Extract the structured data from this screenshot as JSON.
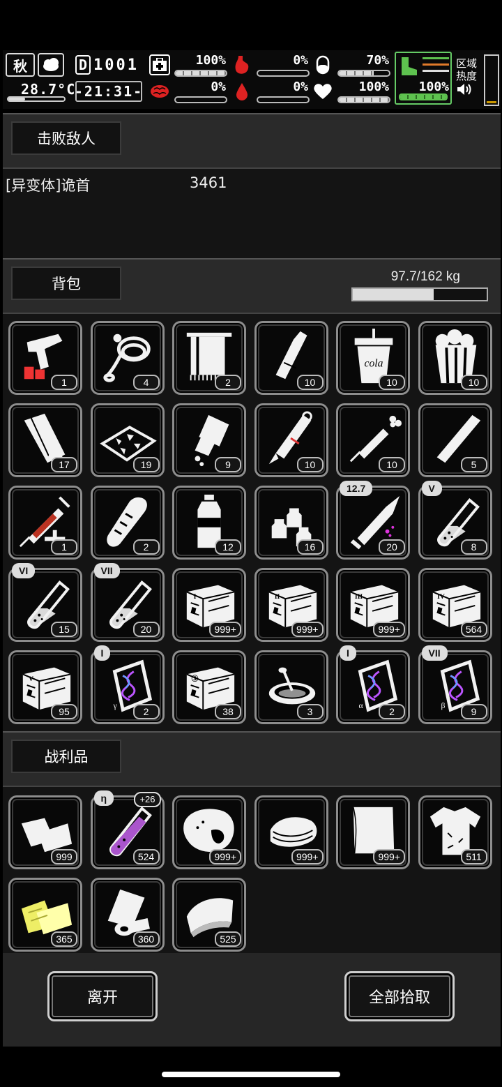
{
  "hud": {
    "season": "秋",
    "temperature": "28.7°C",
    "day": "1001",
    "day_prefix": "D",
    "clock": "-21:31-",
    "stats": [
      {
        "name": "health",
        "icon": "medkit-icon",
        "value": "100%",
        "level": 1.0,
        "color": "#ffffff"
      },
      {
        "name": "hunger",
        "icon": "stomach-icon",
        "value": "0%",
        "level": 0.0,
        "color": "#d33"
      },
      {
        "name": "pill",
        "icon": "pill-icon",
        "value": "70%",
        "level": 0.7,
        "color": "#ffffff"
      },
      {
        "name": "brain",
        "icon": "brain-icon",
        "value": "0%",
        "level": 0.0,
        "color": "#d33"
      },
      {
        "name": "blood",
        "icon": "blood-drop-icon",
        "value": "0%",
        "level": 0.0,
        "color": "#d33"
      },
      {
        "name": "heart",
        "icon": "heart-icon",
        "value": "100%",
        "level": 1.0,
        "color": "#ffffff"
      }
    ],
    "stamina": {
      "value": "100%",
      "level": 1.0,
      "color": "#5ec24f"
    },
    "zone_label_line1": "区域",
    "zone_label_line2": "热度"
  },
  "defeat": {
    "title": "击败敌人",
    "enemy_name": "[异变体]诡首",
    "enemy_count": "3461"
  },
  "backpack": {
    "title": "背包",
    "weight": "97.7/162 kg",
    "weight_level": 0.603,
    "items": [
      {
        "icon": "flare-gun-icon",
        "qty": "1"
      },
      {
        "icon": "rope-icon",
        "qty": "4"
      },
      {
        "icon": "towel-icon",
        "qty": "2"
      },
      {
        "icon": "bottle-icon",
        "qty": "10"
      },
      {
        "icon": "cola-cup-icon",
        "qty": "10",
        "label": "cola"
      },
      {
        "icon": "popcorn-icon",
        "qty": "10"
      },
      {
        "icon": "bandage-icon",
        "qty": "17"
      },
      {
        "icon": "snack-tray-icon",
        "qty": "19"
      },
      {
        "icon": "pill-bottle-icon",
        "qty": "9"
      },
      {
        "icon": "injector-icon",
        "qty": "10"
      },
      {
        "icon": "syringe-icon",
        "qty": "10"
      },
      {
        "icon": "cigarette-icon",
        "qty": "5"
      },
      {
        "icon": "blood-syringe-icon",
        "qty": "1"
      },
      {
        "icon": "bread-icon",
        "qty": "2"
      },
      {
        "icon": "water-bottle-icon",
        "qty": "12"
      },
      {
        "icon": "vials-icon",
        "qty": "16"
      },
      {
        "icon": "bullet-icon",
        "qty": "20",
        "tag": "12.7"
      },
      {
        "icon": "test-tube-icon",
        "qty": "8",
        "tag": "V"
      },
      {
        "icon": "test-tube-icon",
        "qty": "15",
        "tag": "VI"
      },
      {
        "icon": "test-tube-icon",
        "qty": "20",
        "tag": "VII"
      },
      {
        "icon": "crate-icon",
        "qty": "999+",
        "roman": "I"
      },
      {
        "icon": "crate-icon",
        "qty": "999+",
        "roman": "II"
      },
      {
        "icon": "crate-icon",
        "qty": "999+",
        "roman": "III"
      },
      {
        "icon": "crate-icon",
        "qty": "564",
        "roman": "IV"
      },
      {
        "icon": "crate-icon",
        "qty": "95",
        "roman": "V"
      },
      {
        "icon": "dna-capsule-icon",
        "qty": "2",
        "tag": "I",
        "greek": "γ"
      },
      {
        "icon": "crate-icon",
        "qty": "38",
        "roman": "Ⓢ"
      },
      {
        "icon": "bowl-icon",
        "qty": "3"
      },
      {
        "icon": "dna-capsule-icon",
        "qty": "2",
        "tag": "I",
        "greek": "α"
      },
      {
        "icon": "dna-capsule-icon",
        "qty": "9",
        "tag": "VII",
        "greek": "β"
      }
    ]
  },
  "loot": {
    "title": "战利品",
    "items": [
      {
        "icon": "cloth-icon",
        "qty": "999"
      },
      {
        "icon": "purple-tube-icon",
        "qty": "524",
        "tag": "η",
        "plus": "+26"
      },
      {
        "icon": "rock-meat-icon",
        "qty": "999+"
      },
      {
        "icon": "fabric-stack-icon",
        "qty": "999+"
      },
      {
        "icon": "paper-sheet-icon",
        "qty": "999+"
      },
      {
        "icon": "torn-shirt-icon",
        "qty": "511"
      },
      {
        "icon": "yellow-cloth-icon",
        "qty": "365"
      },
      {
        "icon": "roll-icon",
        "qty": "360"
      },
      {
        "icon": "folded-cloth-icon",
        "qty": "525"
      }
    ]
  },
  "buttons": {
    "leave": "离开",
    "take_all": "全部拾取"
  }
}
